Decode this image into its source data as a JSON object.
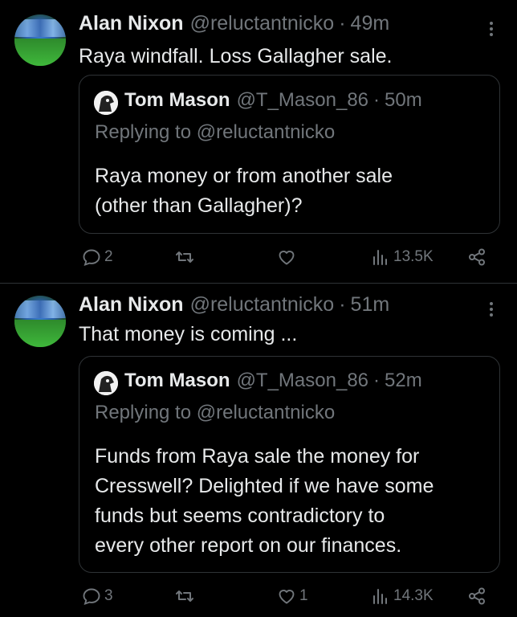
{
  "tweets": [
    {
      "author_name": "Alan Nixon",
      "author_handle": "@reluctantnicko",
      "separator": "·",
      "time": "49m",
      "text_lines": [
        "Raya windfall. Loss Gallagher sale."
      ],
      "quote": {
        "author_name": "Tom Mason",
        "author_handle": "@T_Mason_86",
        "time": "50m",
        "reply_prefix": "Replying to ",
        "reply_to": "@reluctantnicko",
        "text_lines": [
          "Raya money or from another sale",
          "(other than Gallagher)?"
        ]
      },
      "actions": {
        "replies": "2",
        "retweets": "",
        "likes": "",
        "views": "13.5K"
      }
    },
    {
      "author_name": "Alan Nixon",
      "author_handle": "@reluctantnicko",
      "separator": "·",
      "time": "51m",
      "text_lines": [
        "That money is coming ..."
      ],
      "quote": {
        "author_name": "Tom Mason",
        "author_handle": "@T_Mason_86",
        "time": "52m",
        "reply_prefix": "Replying to ",
        "reply_to": "@reluctantnicko",
        "text_lines": [
          "Funds from Raya sale the money for",
          "Cresswell? Delighted if we have some",
          "funds but seems contradictory to",
          "every other report on our finances."
        ]
      },
      "actions": {
        "replies": "3",
        "retweets": "",
        "likes": "1",
        "views": "14.3K"
      }
    }
  ],
  "icons": {
    "reply": "reply-icon",
    "retweet": "retweet-icon",
    "like": "heart-icon",
    "views": "views-icon",
    "share": "share-icon",
    "more": "more-icon"
  },
  "colors": {
    "background": "#000000",
    "text": "#e7e9ea",
    "muted": "#71767b",
    "border": "#2f3336"
  }
}
